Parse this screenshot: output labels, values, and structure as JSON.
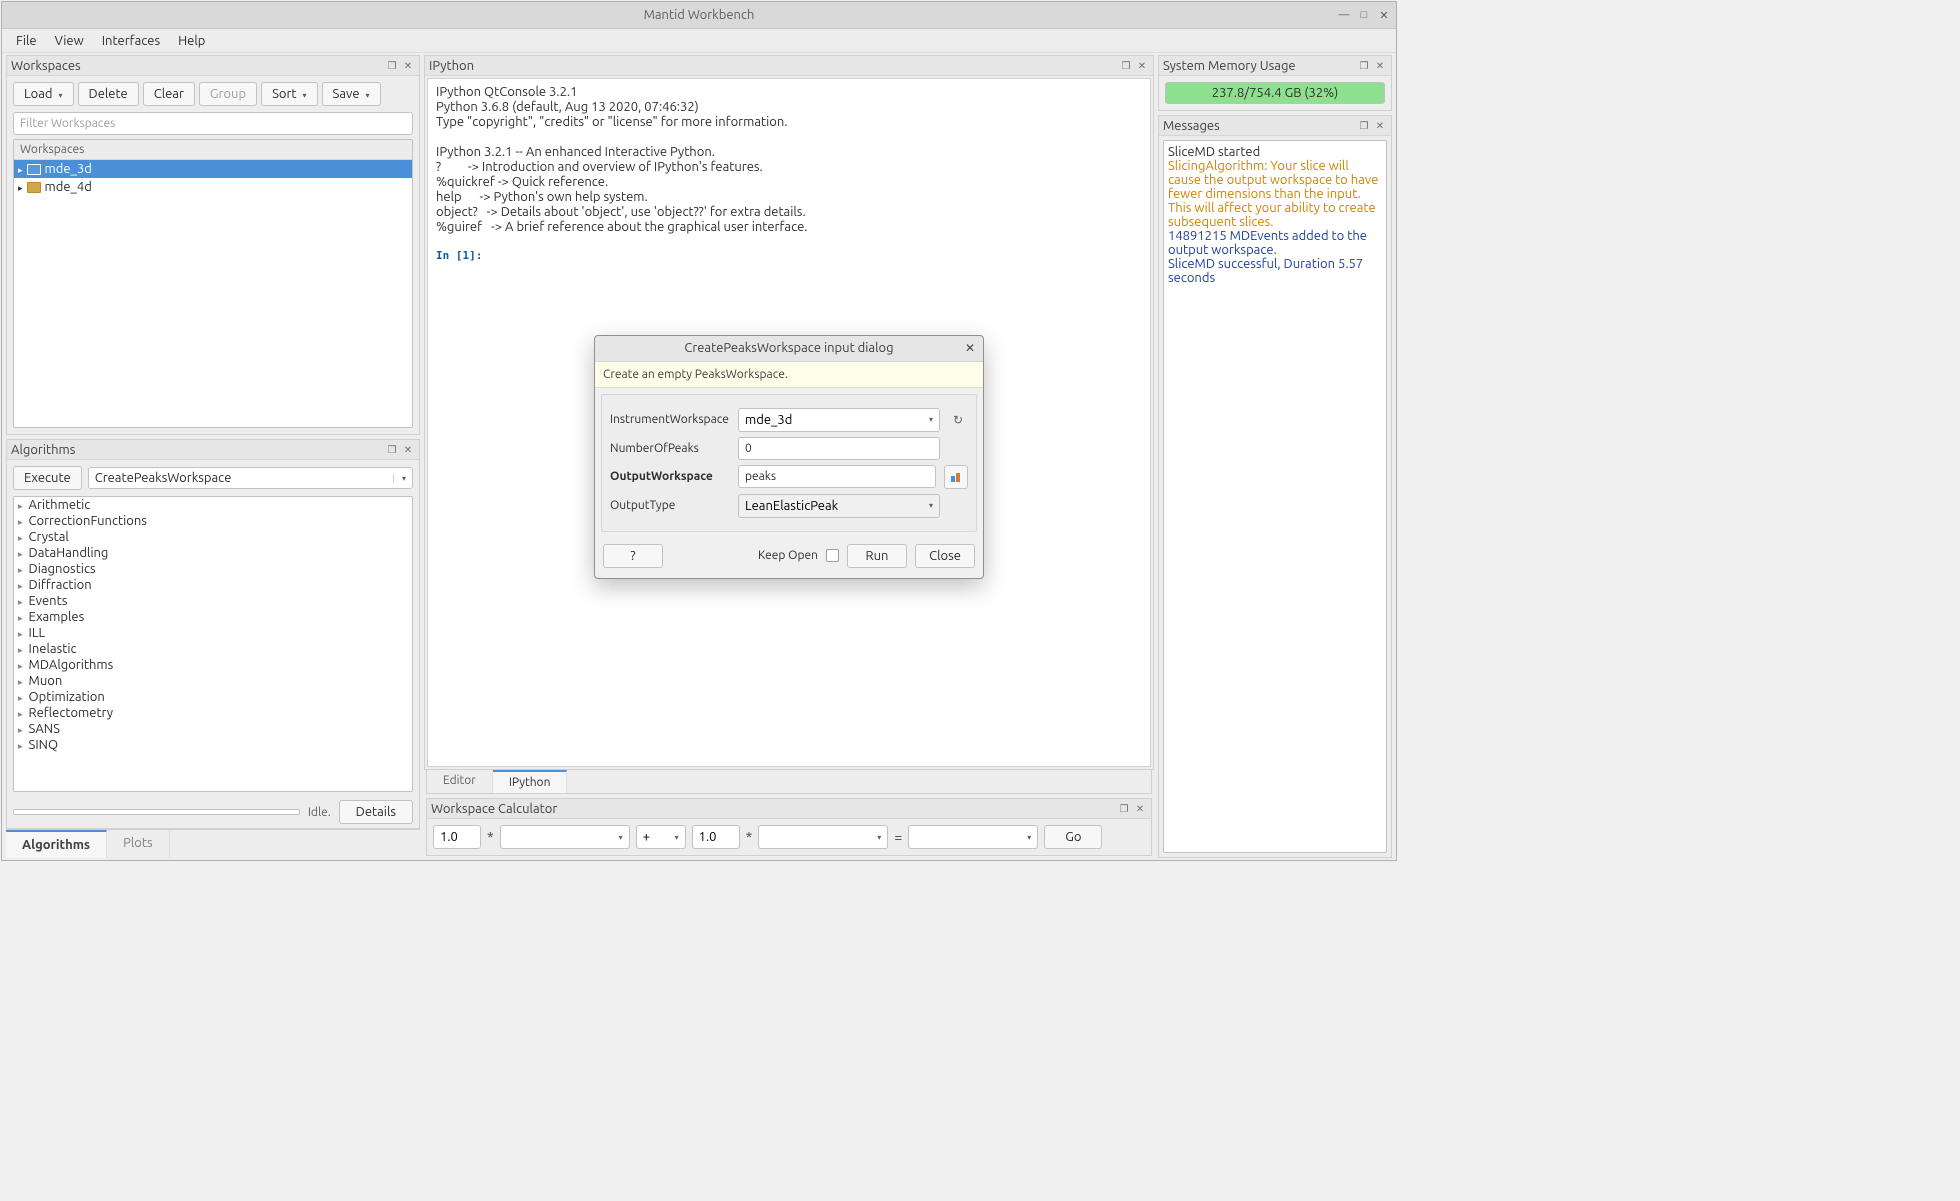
{
  "window": {
    "title": "Mantid Workbench"
  },
  "menubar": [
    "File",
    "View",
    "Interfaces",
    "Help"
  ],
  "workspaces": {
    "title": "Workspaces",
    "load": "Load",
    "delete": "Delete",
    "clear": "Clear",
    "group": "Group",
    "sort": "Sort",
    "save": "Save",
    "filter_placeholder": "Filter Workspaces",
    "tree_header": "Workspaces",
    "items": [
      {
        "name": "mde_3d",
        "selected": true
      },
      {
        "name": "mde_4d",
        "selected": false
      }
    ]
  },
  "algorithms": {
    "title": "Algorithms",
    "execute": "Execute",
    "selected": "CreatePeaksWorkspace",
    "status_idle": "Idle.",
    "details": "Details",
    "categories": [
      "Arithmetic",
      "CorrectionFunctions",
      "Crystal",
      "DataHandling",
      "Diagnostics",
      "Diffraction",
      "Events",
      "Examples",
      "ILL",
      "Inelastic",
      "MDAlgorithms",
      "Muon",
      "Optimization",
      "Reflectometry",
      "SANS",
      "SINQ"
    ]
  },
  "left_tabs": {
    "algorithms": "Algorithms",
    "plots": "Plots"
  },
  "ipython": {
    "title": "IPython",
    "content": "IPython QtConsole 3.2.1\nPython 3.6.8 (default, Aug 13 2020, 07:46:32)\nType \"copyright\", \"credits\" or \"license\" for more information.\n\nIPython 3.2.1 -- An enhanced Interactive Python.\n?         -> Introduction and overview of IPython's features.\n%quickref -> Quick reference.\nhelp      -> Python's own help system.\nobject?   -> Details about 'object', use 'object??' for extra details.\n%guiref   -> A brief reference about the graphical user interface.\n",
    "prompt": "In [1]:"
  },
  "center_tabs": {
    "editor": "Editor",
    "ipython": "IPython"
  },
  "calc": {
    "title": "Workspace Calculator",
    "lhs_scale": "1.0",
    "op": "+",
    "rhs_scale": "1.0",
    "eq": "=",
    "go": "Go"
  },
  "memory": {
    "title": "System Memory Usage",
    "text": "237.8/754.4 GB (32%)"
  },
  "messages": {
    "title": "Messages",
    "lines": [
      {
        "cls": "msg-black",
        "text": "SliceMD started"
      },
      {
        "cls": "msg-orange",
        "text": "SlicingAlgorithm: Your slice will cause the output workspace to have fewer dimensions than the input. This will affect your ability to create subsequent slices."
      },
      {
        "cls": "msg-blue",
        "text": "14891215 MDEvents added to the output workspace."
      },
      {
        "cls": "msg-blue",
        "text": "SliceMD successful, Duration 5.57 seconds"
      }
    ]
  },
  "dialog": {
    "title": "CreatePeaksWorkspace input dialog",
    "banner": "Create an empty PeaksWorkspace.",
    "fields": {
      "instrument_label": "InstrumentWorkspace",
      "instrument_value": "mde_3d",
      "npeaks_label": "NumberOfPeaks",
      "npeaks_value": "0",
      "output_label": "OutputWorkspace",
      "output_value": "peaks",
      "type_label": "OutputType",
      "type_value": "LeanElasticPeak"
    },
    "help": "?",
    "keep_open": "Keep Open",
    "run": "Run",
    "close": "Close"
  }
}
